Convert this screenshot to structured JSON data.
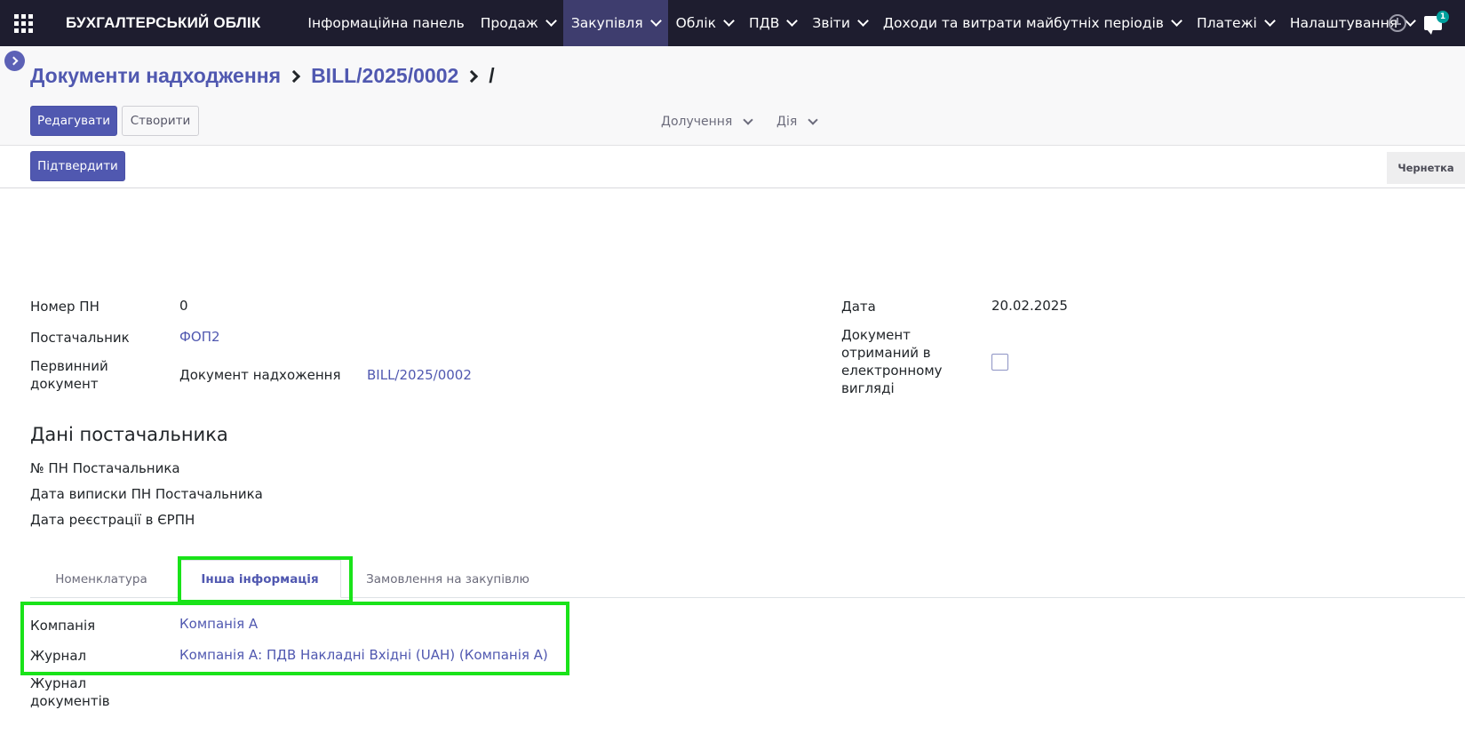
{
  "navbar": {
    "brand": "БУХГАЛТЕРСЬКИЙ ОБЛІК",
    "menu": [
      {
        "label": "Інформаційна панель",
        "dropdown": false,
        "active": false
      },
      {
        "label": "Продаж",
        "dropdown": true,
        "active": false
      },
      {
        "label": "Закупівля",
        "dropdown": true,
        "active": true
      },
      {
        "label": "Облік",
        "dropdown": true,
        "active": false
      },
      {
        "label": "ПДВ",
        "dropdown": true,
        "active": false
      },
      {
        "label": "Звіти",
        "dropdown": true,
        "active": false
      },
      {
        "label": "Доходи та витрати майбутніх періодів",
        "dropdown": true,
        "active": false
      },
      {
        "label": "Платежі",
        "dropdown": true,
        "active": false
      },
      {
        "label": "Налаштування",
        "dropdown": true,
        "active": false
      }
    ],
    "chat_badge": "1"
  },
  "breadcrumb": {
    "items": [
      "Документи надходження",
      "BILL/2025/0002"
    ],
    "current": "/"
  },
  "toolbar": {
    "edit_label": "Редагувати",
    "create_label": "Створити",
    "receive_label": "Долучення",
    "action_label": "Дія"
  },
  "statusbar": {
    "confirm_label": "Підтвердити",
    "status": "Чернетка"
  },
  "form": {
    "tax_number_label": "Номер ПН",
    "tax_number_value": "0",
    "vendor_label": "Постачальник",
    "vendor_value": "ФОП2",
    "primary_doc_label_1": "Первинний",
    "primary_doc_label_2": "документ",
    "primary_doc_type": "Документ надхоження",
    "primary_doc_value": "BILL/2025/0002",
    "date_label": "Дата",
    "date_value": "20.02.2025",
    "electronic_label": [
      "Документ",
      "отриманий в",
      "електронному",
      "вигляді"
    ],
    "electronic_checked": false,
    "supplier_section_title": "Дані постачальника",
    "supplier_tax_number_label": "№ ПН Постачальника",
    "supplier_tax_date_label": "Дата виписки ПН Постачальника",
    "erpn_date_label": "Дата реєстрації в ЄРПН"
  },
  "tabs": [
    {
      "label": "Номенклатура",
      "active": false
    },
    {
      "label": "Інша інформація",
      "active": true
    },
    {
      "label": "Замовлення на закупівлю",
      "active": false
    }
  ],
  "other_info": {
    "company_label": "Компанія",
    "company_value": "Компанія А",
    "journal_label": "Журнал",
    "journal_value": "Компанія А: ПДВ Накладні Вхідні (UAH) (Компанія А)",
    "doc_journal_label_1": "Журнал",
    "doc_journal_label_2": "документів"
  },
  "colors": {
    "navbar_bg": "#1e1d2f",
    "accent": "#5058b0",
    "highlight": "#19e319"
  }
}
